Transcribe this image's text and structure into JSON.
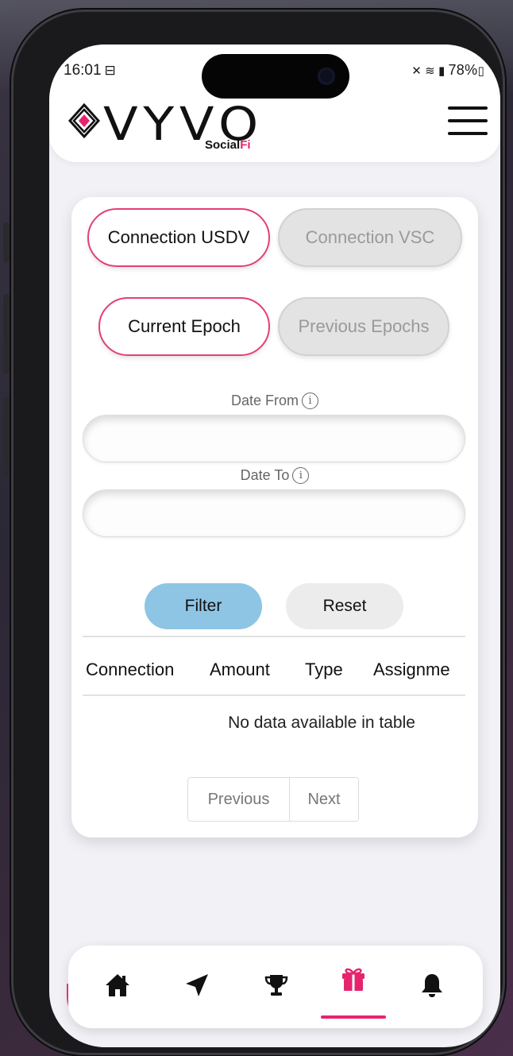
{
  "status_bar": {
    "time": "16:01",
    "battery": "78%"
  },
  "header": {
    "logo_text": "VYVO",
    "logo_sub_prefix": "Social",
    "logo_sub_suffix": "Fi"
  },
  "tabs": {
    "connection_usdv": "Connection USDV",
    "connection_vsc": "Connection VSC",
    "current_epoch": "Current Epoch",
    "previous_epochs": "Previous Epochs"
  },
  "filters": {
    "date_from_label": "Date From",
    "date_to_label": "Date To",
    "date_from_value": "",
    "date_to_value": "",
    "filter_button": "Filter",
    "reset_button": "Reset"
  },
  "table": {
    "columns": [
      "Connection",
      "Amount",
      "Type",
      "Assignme"
    ],
    "empty_message": "No data available in table"
  },
  "pagination": {
    "previous": "Previous",
    "next": "Next"
  },
  "bottom_nav": {
    "items": [
      "home-icon",
      "send-icon",
      "trophy-icon",
      "gift-icon",
      "bell-icon"
    ],
    "active_index": 3
  },
  "colors": {
    "accent_pink": "#e6236e",
    "filter_blue": "#8fc5e4"
  }
}
